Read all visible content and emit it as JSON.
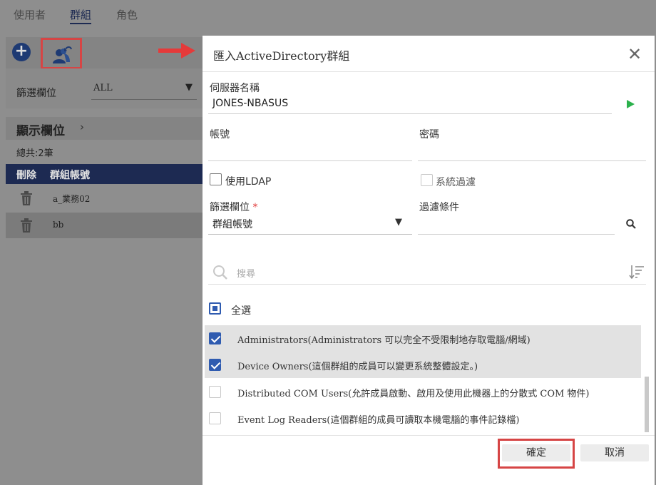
{
  "tabs": [
    {
      "label": "使用者"
    },
    {
      "label": "群組"
    },
    {
      "label": "角色"
    }
  ],
  "toolbar": {
    "add_icon": "plus-circle-icon",
    "import_icon": "import-users-icon"
  },
  "filter": {
    "label": "篩選欄位",
    "value": "ALL"
  },
  "display_columns": {
    "label": "顯示欄位"
  },
  "total": "總共:2筆",
  "list": {
    "headers": [
      "刪除",
      "群組帳號"
    ],
    "rows": [
      {
        "name": "a_業務02"
      },
      {
        "name": "bb"
      }
    ]
  },
  "dialog": {
    "title": "匯入ActiveDirectory群組",
    "server": {
      "label": "伺服器名稱",
      "value": "JONES-NBASUS"
    },
    "account": {
      "label": "帳號",
      "value": ""
    },
    "password": {
      "label": "密碼",
      "value": ""
    },
    "use_ldap": {
      "label": "使用LDAP",
      "checked": false
    },
    "system_filter": {
      "label": "系統過濾",
      "checked": false,
      "disabled": true
    },
    "filter_field": {
      "label": "篩選欄位",
      "required_mark": "*",
      "value": "群組帳號"
    },
    "filter_condition": {
      "label": "過濾條件",
      "value": ""
    },
    "search": {
      "placeholder": "搜尋"
    },
    "select_all": {
      "label": "全選",
      "state": "indeterminate"
    },
    "items": [
      {
        "label": "Administrators(Administrators 可以完全不受限制地存取電腦/網域)",
        "checked": true
      },
      {
        "label": "Device Owners(這個群組的成員可以變更系統整體設定。)",
        "checked": true
      },
      {
        "label": "Distributed COM Users(允許成員啟動、啟用及使用此機器上的分散式 COM 物件)",
        "checked": false
      },
      {
        "label": "Event Log Readers(這個群組的成員可讀取本機電腦的事件記錄檔)",
        "checked": false
      }
    ],
    "ok_label": "確定",
    "cancel_label": "取消"
  },
  "colors": {
    "brand_navy": "#1d2a52",
    "check_blue": "#2f5bb0",
    "run_green": "#2bb14c",
    "highlight_red": "#d64545"
  }
}
